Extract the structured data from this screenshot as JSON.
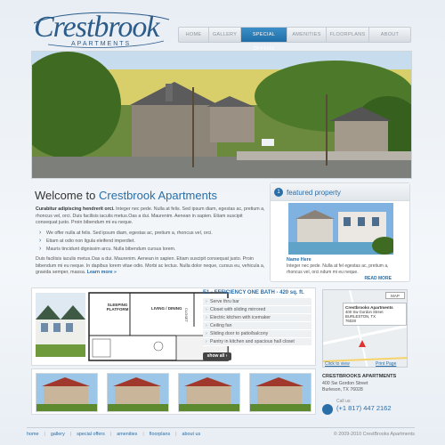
{
  "brand": {
    "name": "Crestbrook",
    "sub": "APARTMENTS"
  },
  "nav": [
    {
      "label": "HOME",
      "active": false
    },
    {
      "label": "GALLERY",
      "active": false
    },
    {
      "label": "SPECIAL OFFERS",
      "active": true
    },
    {
      "label": "AMENITIES",
      "active": false
    },
    {
      "label": "FLOORPLANS",
      "active": false
    },
    {
      "label": "ABOUT",
      "active": false
    }
  ],
  "welcome": {
    "prefix": "Welcome to ",
    "name": "Crestbrook Apartments",
    "lead": "Curabitur adipiscing hendrerit orci.",
    "para1": " Integer nec pede. Nulla at felis. Sed ipsum diam, egestas ac, pretium a, rhoncus vel, orci. Duis facilisis iaculis metus.Oas a dui. Maurenim. Aenean in sapien. Etiam suscipit consequat justo. Proin bibendum mi eu neque.",
    "bullets": [
      "We offer  nulla at felis. Sed ipsum diam, egestas ac, pretium a, rhoncus vel, orci.",
      "Etiam at odio non ligula eleifend imperdiet.",
      "Mauris tincidunt dignissim arcu. Nulla bibendum cursus lorem."
    ],
    "para2": "Duis facilisis iaculis metus.Oas a dui. Maurenim. Aenean in sapien. Etiam suscipit consequat justo. Proin bibendum mi eu neque. In dapibus lorem vitae odio. Morbi ac lectus. Nulla dolor neque, cursus eu, vehicula a, gravida semper, massa.",
    "learn_more": "Learn more »"
  },
  "featured": {
    "number": "1",
    "title": "featured property",
    "name": "Name Here",
    "text": "Integer nec pede. Nulla at fel egestas ac, pretium a, rhoncus vel, orci.ndum mi eu neque.",
    "read_more": "READ MORE"
  },
  "floorplan": {
    "title": "E1 - EFFICIENCY ONE BATH - 420 sq. ft.",
    "rooms": [
      "SLEEPING PLATFORM",
      "LIVING / DINING",
      "CLOSET"
    ],
    "features": [
      "Serve thru bar",
      "Closet with sliding mirrored",
      "Electric kitchen with icemaker",
      "Ceiling fan",
      "Sliding door to patio/balcony",
      "Pantry in kitchen and spacious hall closet"
    ],
    "show_all": "show all ›"
  },
  "map": {
    "button": "MAP",
    "addr_name": "Crestbrooks Apartments",
    "addr_line1": "400 Sw Gordon Street",
    "addr_line2": "BURLESTON, TX",
    "addr_zip": "76028",
    "view_larger": "Click to view",
    "print": "Print Page"
  },
  "contact": {
    "name": "CRESTBROOKS APARTMENTS",
    "line1": "400 Sw Gordon Street",
    "line2": "Burleson, TX 76028",
    "call": "Call us:",
    "phone": "(+1 817) 447 2162"
  },
  "footer": {
    "links": [
      "home",
      "gallery",
      "special offers",
      "amenities",
      "floorplans",
      "about us"
    ],
    "copyright": "© 2009-2010 CrestBrooks Apartments"
  },
  "colors": {
    "accent": "#2a6ea8",
    "nav_active": "#2b7fbf"
  }
}
